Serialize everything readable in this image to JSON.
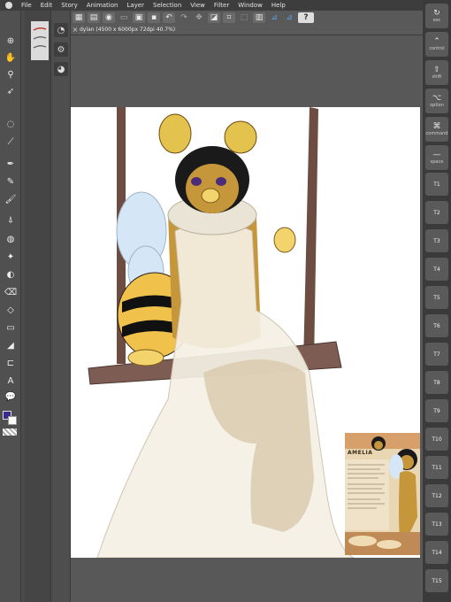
{
  "menubar": {
    "items": [
      "File",
      "Edit",
      "Story",
      "Animation",
      "Layer",
      "Selection",
      "View",
      "Filter",
      "Window",
      "Help"
    ]
  },
  "commandbar": {
    "icons": [
      "grid-icon",
      "layout-icon",
      "preview-icon",
      "new-icon",
      "open-icon",
      "save-icon",
      "undo-icon",
      "redo-icon",
      "transform-icon",
      "fill-icon",
      "crop-icon",
      "select-icon",
      "ruler-icon",
      "snap-icon",
      "snap-alt-icon",
      "help-icon"
    ]
  },
  "document": {
    "tab_title": "dylan (4500 x 6000px 72dpi 40.7%)"
  },
  "colors": {
    "main_color": "#3b2a8a",
    "sub_color": "#ffffff"
  },
  "reference_sheet": {
    "title": "AMELIA"
  },
  "sidebar": {
    "keys": [
      {
        "icon": "↻",
        "label": "esc"
      },
      {
        "icon": "⌃",
        "label": "control"
      },
      {
        "icon": "⇧",
        "label": "shift"
      },
      {
        "icon": "⌥",
        "label": "option"
      },
      {
        "icon": "⌘",
        "label": "command"
      },
      {
        "icon": "—",
        "label": "space"
      }
    ],
    "tkeys": [
      "T1",
      "T2",
      "T3",
      "T4",
      "T5",
      "T6",
      "T7",
      "T8",
      "T9",
      "T10",
      "T11",
      "T12",
      "T13",
      "T14",
      "T15"
    ]
  }
}
